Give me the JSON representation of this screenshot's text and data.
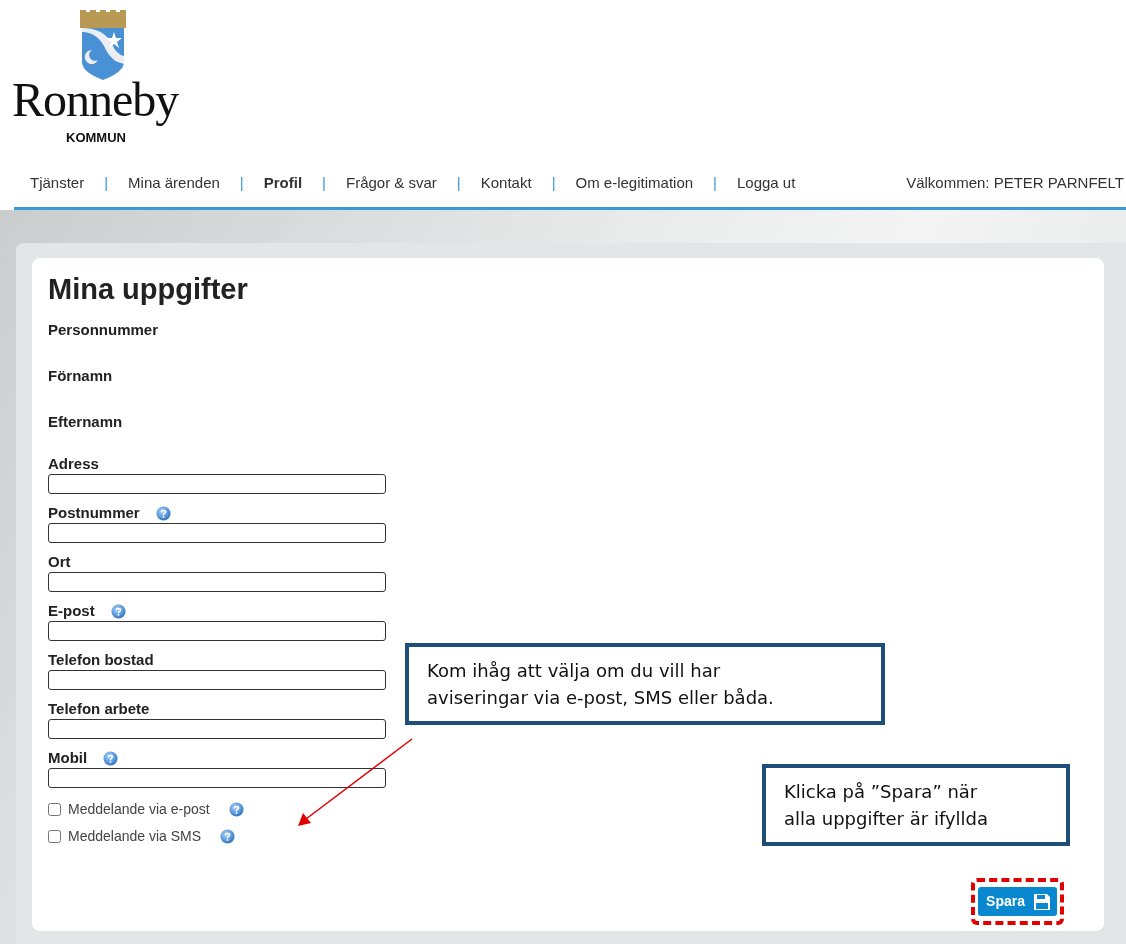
{
  "logo": {
    "name": "Ronneby",
    "subtitle": "KOMMUN"
  },
  "nav": [
    {
      "label": "Tjänster",
      "selected": false
    },
    {
      "separator": "|",
      "label": "Mina ärenden",
      "selected": false
    },
    {
      "separator": "|",
      "label": "Profil",
      "selected": true
    },
    {
      "separator": "|",
      "label": "Frågor & svar",
      "selected": false
    },
    {
      "separator": "|",
      "label": "Kontakt",
      "selected": false
    },
    {
      "separator": "|",
      "label": "Om e-legitimation",
      "selected": false
    },
    {
      "separator": "|",
      "label": "Logga ut",
      "selected": false
    }
  ],
  "welcome": "Välkommen: PETER PARNFELT",
  "form": {
    "title": "Mina uppgifter",
    "fields": [
      {
        "kind": "static",
        "label": "Personnummer"
      },
      {
        "kind": "static",
        "label": "Förnamn"
      },
      {
        "kind": "static",
        "label": "Efternamn"
      },
      {
        "kind": "input",
        "label": "Adress",
        "help": false
      },
      {
        "kind": "input",
        "label": "Postnummer",
        "help": true
      },
      {
        "kind": "input",
        "label": "Ort",
        "help": false
      },
      {
        "kind": "input",
        "label": "E-post",
        "help": true
      },
      {
        "kind": "input",
        "label": "Telefon bostad",
        "help": false
      },
      {
        "kind": "input",
        "label": "Telefon arbete",
        "help": false
      },
      {
        "kind": "input",
        "label": "Mobil",
        "help": true
      }
    ],
    "checkboxes": [
      {
        "label": "Meddelande via e-post",
        "checked": false,
        "help": true
      },
      {
        "label": "Meddelande via SMS",
        "checked": false,
        "help": true
      }
    ],
    "save_button": "Spara"
  },
  "callouts": [
    {
      "lines": [
        "Kom ihåg att välja om du vill har",
        "aviseringar via e-post, SMS eller båda."
      ]
    },
    {
      "lines": [
        "Klicka på ”Spara” när",
        "alla uppgifter är ifyllda"
      ]
    }
  ]
}
